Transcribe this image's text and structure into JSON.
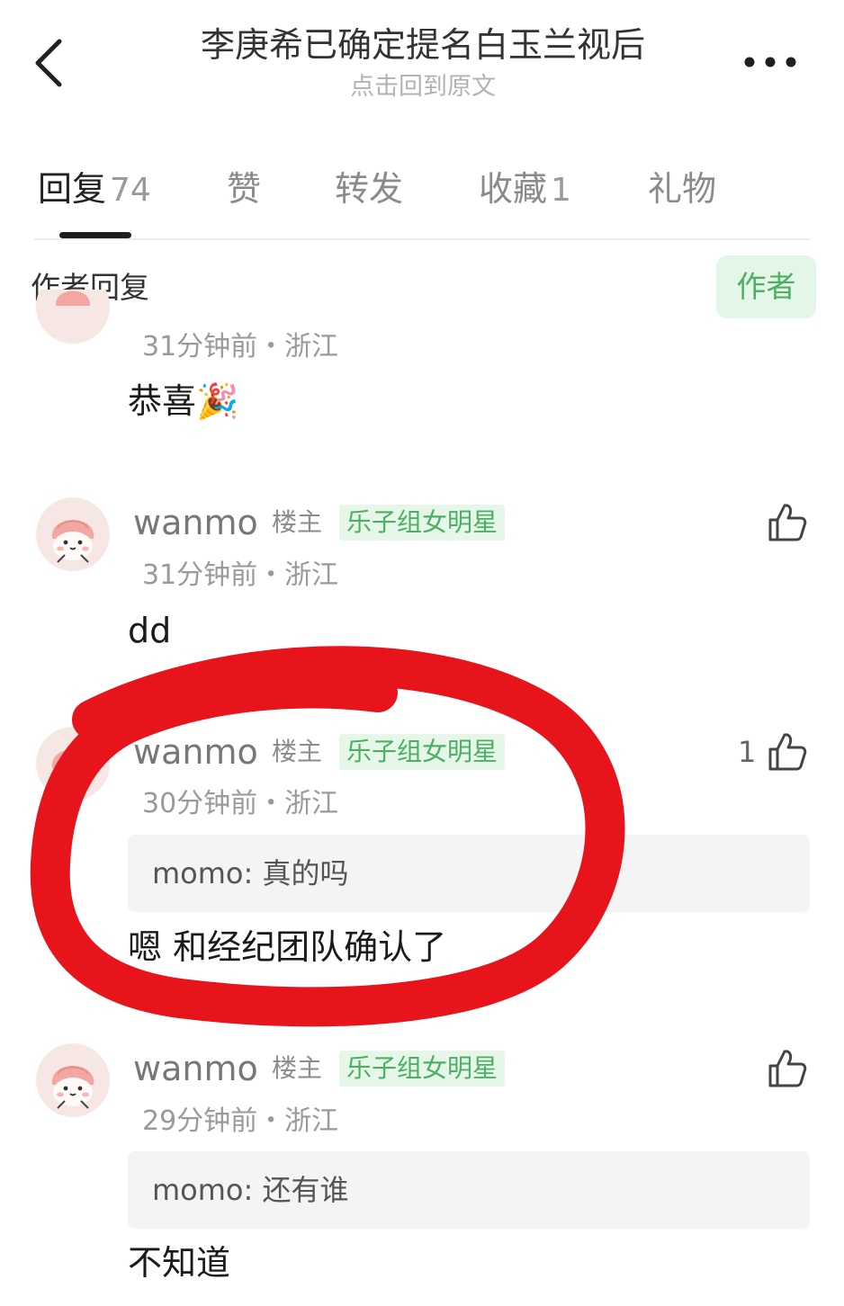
{
  "header": {
    "back_icon": "chevron-left-icon",
    "title": "李庚希已确定提名白玉兰视后",
    "subtitle": "点击回到原文",
    "more_icon": "more-horizontal-icon"
  },
  "tabs": [
    {
      "label": "回复",
      "count": "74",
      "active": true
    },
    {
      "label": "赞",
      "count": ""
    },
    {
      "label": "转发",
      "count": ""
    },
    {
      "label": "收藏",
      "count": "1"
    },
    {
      "label": "礼物",
      "count": ""
    }
  ],
  "section": {
    "label": "作者回复",
    "author_button": "作者"
  },
  "comments": [
    {
      "meta": "31分钟前・浙江",
      "content": "恭喜🎉"
    },
    {
      "username": "wanmo",
      "role": "楼主",
      "badge": "乐子组女明星",
      "meta": "31分钟前・浙江",
      "content": "dd",
      "likes": ""
    },
    {
      "username": "wanmo",
      "role": "楼主",
      "badge": "乐子组女明星",
      "meta": "30分钟前・浙江",
      "quote": "momo: 真的吗",
      "content": "嗯 和经纪团队确认了",
      "likes": "1"
    },
    {
      "username": "wanmo",
      "role": "楼主",
      "badge": "乐子组女明星",
      "meta": "29分钟前・浙江",
      "quote": "momo: 还有谁",
      "content": "不知道",
      "likes": ""
    }
  ],
  "colors": {
    "accent_green": "#4caf63",
    "badge_bg": "#e6f7e9",
    "annotation_red": "#e8141c"
  },
  "icons": {
    "like": "thumbs-up-icon",
    "avatar": "cartoon-avatar-icon",
    "emoji": "party-popper-icon"
  }
}
